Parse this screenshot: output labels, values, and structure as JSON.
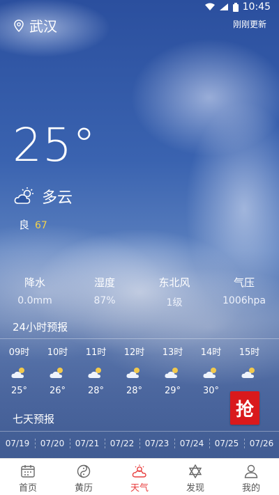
{
  "status_bar": {
    "time": "10:45"
  },
  "header": {
    "city": "武汉",
    "update_status": "刚刚更新"
  },
  "current": {
    "temperature": "25°",
    "condition": "多云",
    "air_quality_label": "良",
    "air_quality_value": "67"
  },
  "details": [
    {
      "label": "降水",
      "value": "0.0mm"
    },
    {
      "label": "湿度",
      "value": "87%"
    },
    {
      "label": "东北风",
      "value": "1级"
    },
    {
      "label": "气压",
      "value": "1006hpa"
    }
  ],
  "hourly": {
    "title": "24小时预报",
    "items": [
      {
        "time": "09时",
        "temp": "25°",
        "icon": "partly-cloudy-icon"
      },
      {
        "time": "10时",
        "temp": "26°",
        "icon": "partly-cloudy-icon"
      },
      {
        "time": "11时",
        "temp": "28°",
        "icon": "partly-cloudy-icon"
      },
      {
        "time": "12时",
        "temp": "28°",
        "icon": "partly-cloudy-icon"
      },
      {
        "time": "13时",
        "temp": "29°",
        "icon": "partly-cloudy-icon"
      },
      {
        "time": "14时",
        "temp": "30°",
        "icon": "partly-cloudy-icon"
      },
      {
        "time": "15时",
        "temp": "",
        "icon": "partly-cloudy-icon"
      }
    ]
  },
  "promo": {
    "label": "抢",
    "color": "#d9191c"
  },
  "daily": {
    "title": "七天预报",
    "dates": [
      "07/19",
      "07/20",
      "07/21",
      "07/22",
      "07/23",
      "07/24",
      "07/25",
      "07/26"
    ]
  },
  "tabs": [
    {
      "label": "首页",
      "icon": "calendar-icon",
      "active": false
    },
    {
      "label": "黄历",
      "icon": "yin-yang-icon",
      "active": false
    },
    {
      "label": "天气",
      "icon": "weather-icon",
      "active": true
    },
    {
      "label": "发现",
      "icon": "star-of-david-icon",
      "active": false
    },
    {
      "label": "我的",
      "icon": "person-icon",
      "active": false
    }
  ],
  "colors": {
    "accent_active": "#e83e3e",
    "aqi": "#f3d24c",
    "tabbar_bg": "#ffffff"
  }
}
